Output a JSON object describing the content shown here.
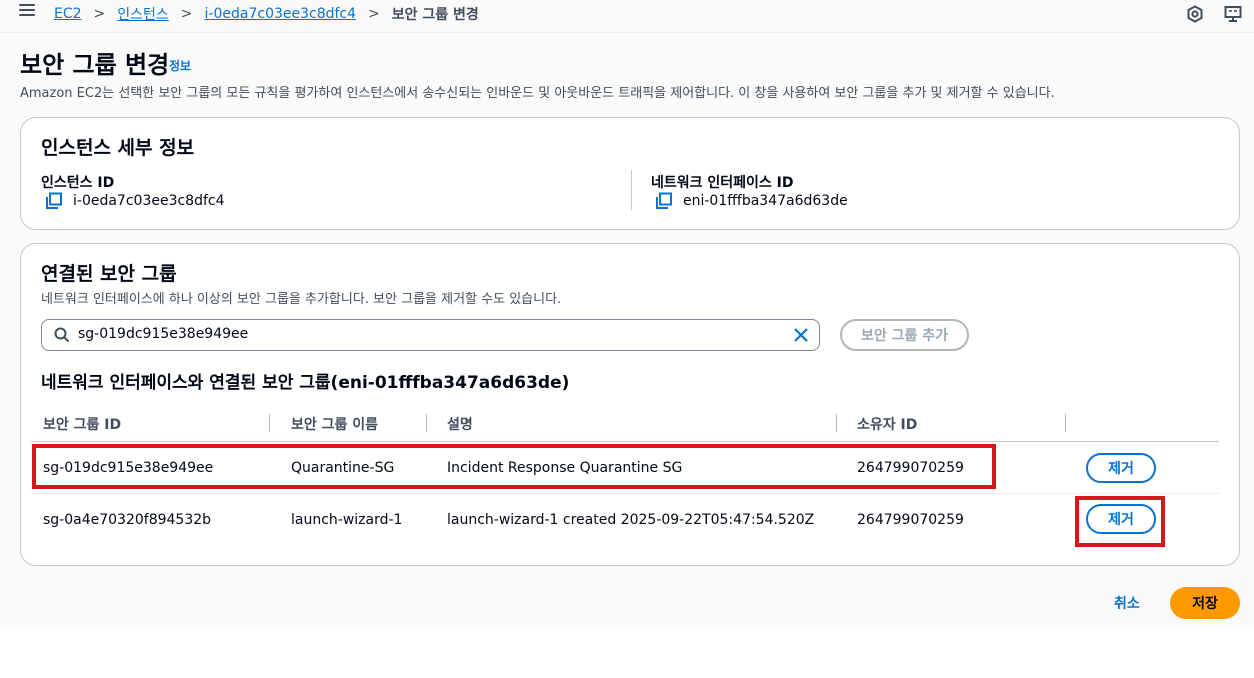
{
  "breadcrumb": {
    "items": [
      "EC2",
      "인스턴스",
      "i-0eda7c03ee3c8dfc4"
    ],
    "separator": ">",
    "current": "보안 그룹 변경"
  },
  "header": {
    "title": "보안 그룹 변경",
    "info_label": "정보",
    "description": "Amazon EC2는 선택한 보안 그룹의 모든 규칙을 평가하여 인스턴스에서 송수신되는 인바운드 및 아웃바운드 트래픽을 제어합니다. 이 창을 사용하여 보안 그룹을 추가 및 제거할 수 있습니다."
  },
  "instance_details": {
    "title": "인스턴스 세부 정보",
    "instance_id_label": "인스턴스 ID",
    "instance_id_value": "i-0eda7c03ee3c8dfc4",
    "eni_label": "네트워크 인터페이스 ID",
    "eni_value": "eni-01fffba347a6d63de"
  },
  "security_groups": {
    "title": "연결된 보안 그룹",
    "description": "네트워크 인터페이스에 하나 이상의 보안 그룹을 추가합니다. 보안 그룹을 제거할 수도 있습니다.",
    "search_value": "sg-019dc915e38e949ee",
    "add_button": "보안 그룹 추가",
    "table_title": "네트워크 인터페이스와 연결된 보안 그룹(eni-01fffba347a6d63de)",
    "columns": [
      "보안 그룹 ID",
      "보안 그룹 이름",
      "설명",
      "소유자 ID"
    ],
    "rows": [
      {
        "id": "sg-019dc915e38e949ee",
        "name": "Quarantine-SG",
        "description": "Incident Response Quarantine SG",
        "owner": "264799070259",
        "action": "제거"
      },
      {
        "id": "sg-0a4e70320f894532b",
        "name": "launch-wizard-1",
        "description": "launch-wizard-1 created 2025-09-22T05:47:54.520Z",
        "owner": "264799070259",
        "action": "제거"
      }
    ]
  },
  "footer": {
    "cancel": "취소",
    "save": "저장"
  },
  "colors": {
    "link": "#0972d3",
    "primary_button": "#ff9900",
    "highlight": "#d6181e"
  }
}
